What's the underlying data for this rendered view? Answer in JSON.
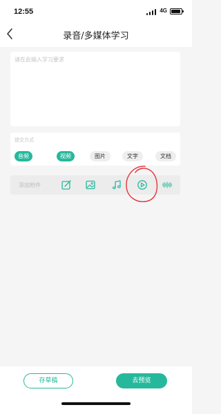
{
  "status_bar": {
    "time": "12:55",
    "network": "4G"
  },
  "nav": {
    "title": "录音/多媒体学习",
    "back_icon": "chevron-left-icon"
  },
  "requirement": {
    "placeholder": "请在此输入学习要求",
    "value": ""
  },
  "submit_method": {
    "label": "提交方式",
    "options": [
      {
        "label": "音频",
        "selected": true
      },
      {
        "label": "视频",
        "selected": true
      },
      {
        "label": "图片",
        "selected": false
      },
      {
        "label": "文字",
        "selected": false
      },
      {
        "label": "文档",
        "selected": false
      }
    ]
  },
  "attachments": {
    "label": "添加附件",
    "icons": [
      "edit-icon",
      "image-icon",
      "music-note-icon",
      "video-play-icon",
      "audio-wave-icon"
    ]
  },
  "actions": {
    "save_draft": "存草稿",
    "preview": "去预览"
  },
  "colors": {
    "accent": "#26b89c",
    "chip_inactive": "#eeeeee",
    "background": "#f5f5f5",
    "annotation": "#e5333b"
  }
}
